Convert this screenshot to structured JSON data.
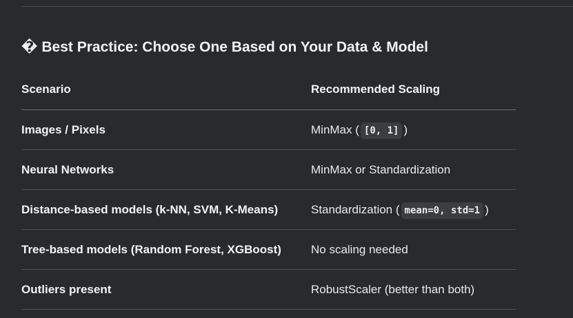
{
  "section": {
    "heading_icon": "�",
    "heading": "Best Practice: Choose One Based on Your Data & Model"
  },
  "table": {
    "headers": [
      "Scenario",
      "Recommended Scaling"
    ],
    "rows": [
      {
        "scenario": "Images / Pixels",
        "pre": "MinMax (",
        "code": "[0, 1]",
        "post": ")"
      },
      {
        "scenario": "Neural Networks",
        "pre": "MinMax or Standardization",
        "code": "",
        "post": ""
      },
      {
        "scenario": "Distance-based models (k-NN, SVM, K-Means)",
        "pre": "Standardization (",
        "code": "mean=0, std=1",
        "post": ")"
      },
      {
        "scenario": "Tree-based models (Random Forest, XGBoost)",
        "pre": "No scaling needed",
        "code": "",
        "post": ""
      },
      {
        "scenario": "Outliers present",
        "pre": "RobustScaler (better than both)",
        "code": "",
        "post": ""
      }
    ]
  }
}
